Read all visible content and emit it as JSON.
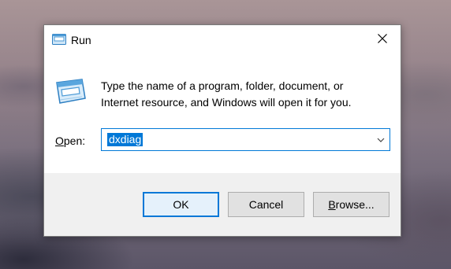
{
  "window": {
    "title": "Run",
    "close_glyph": "✕"
  },
  "icons": {
    "title": "run-app-icon",
    "main": "run-app-icon",
    "close": "close-icon",
    "dropdown": "chevron-down-icon"
  },
  "message": {
    "line1": "Type the name of a program, folder, document, or",
    "line2": "Internet resource, and Windows will open it for you."
  },
  "open": {
    "label_accel": "O",
    "label_rest": "pen:",
    "value": "dxdiag"
  },
  "buttons": {
    "ok": "OK",
    "cancel": "Cancel",
    "browse_accel": "B",
    "browse_rest": "rowse..."
  },
  "colors": {
    "accent": "#0078d7",
    "footer_bg": "#f0f0f0",
    "button_bg": "#e1e1e1"
  }
}
